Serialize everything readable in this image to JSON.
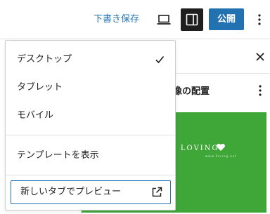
{
  "toolbar": {
    "save_draft_label": "下書き保存",
    "preview_icon": "laptop-icon",
    "sidebar_toggle_icon": "sidebar-icon",
    "publish_label": "公開",
    "options_icon": "more-vertical-icon"
  },
  "preview_menu": {
    "device_options": [
      {
        "label": "デスクトップ",
        "selected": true
      },
      {
        "label": "タブレット",
        "selected": false
      },
      {
        "label": "モバイル",
        "selected": false
      }
    ],
    "show_template_label": "テンプレートを表示",
    "new_tab_preview_label": "新しいタブでプレビュー",
    "new_tab_icon": "external-link-icon"
  },
  "editor_sidebar": {
    "close_icon": "close-icon",
    "block_title": "画像の配置",
    "block_options_icon": "more-vertical-icon",
    "preview_text": "H LOVING",
    "preview_caption": "www.hlving.net",
    "preview_background": "#3fa638"
  },
  "colors": {
    "accent": "#2271b1",
    "toggle_active": "#1e1e1e",
    "preview_green": "#3fa638"
  }
}
